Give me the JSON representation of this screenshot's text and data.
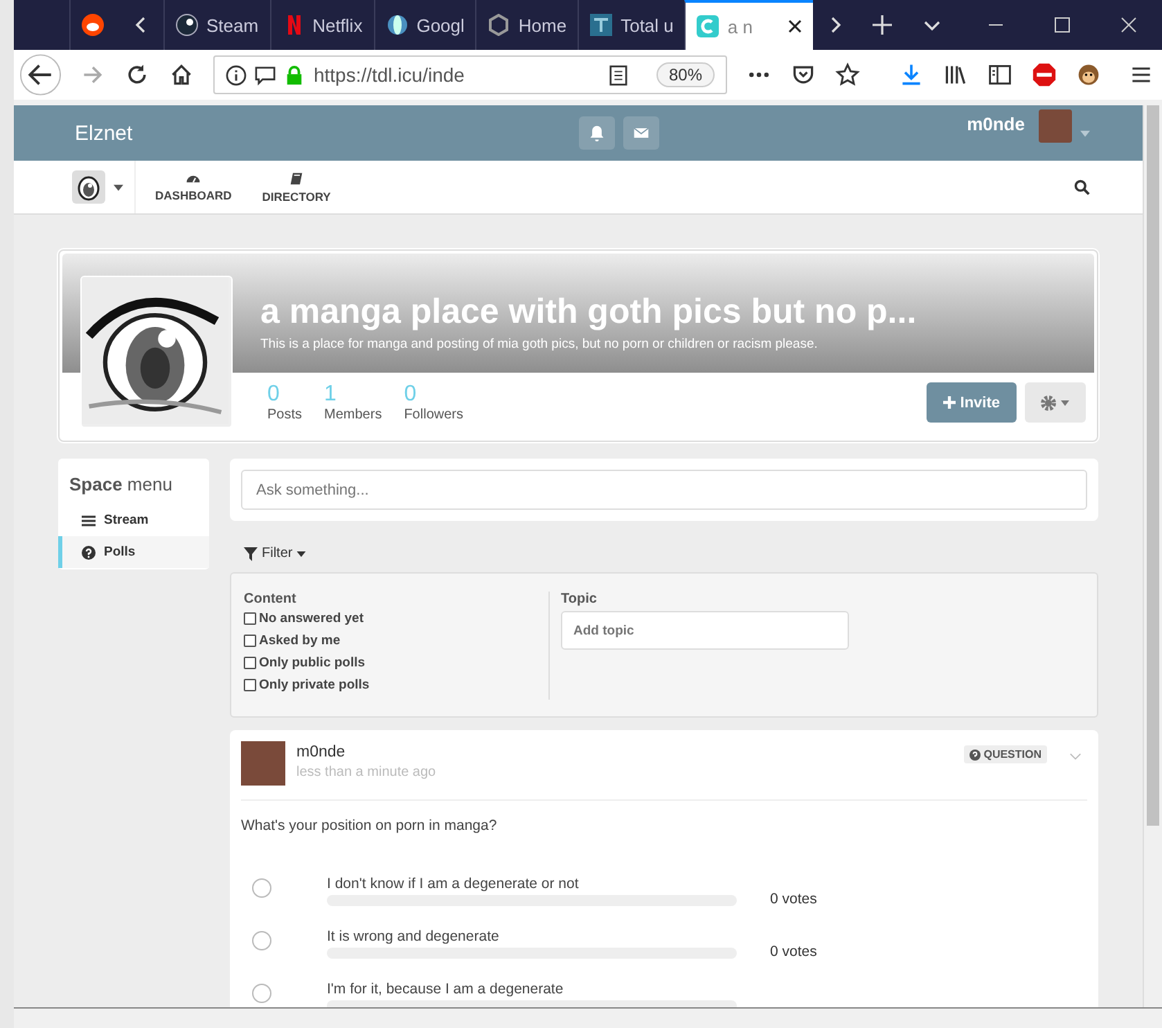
{
  "browser": {
    "tabs": [
      {
        "kind": "reddit",
        "selected": false
      },
      {
        "label": "Steam",
        "kind": "steam",
        "selected": false
      },
      {
        "label": "Netflix",
        "kind": "netflix",
        "selected": false
      },
      {
        "label": "Googl",
        "kind": "globe",
        "selected": false
      },
      {
        "label": "Home",
        "kind": "hex",
        "selected": false
      },
      {
        "label": "Total u",
        "kind": "square",
        "selected": false
      },
      {
        "label": "a n",
        "kind": "app",
        "selected": true
      }
    ],
    "url": "https://tdl.icu/inde",
    "zoom": "80%"
  },
  "navbar": {
    "brand": "Elznet",
    "user": "m0nde"
  },
  "nav": [
    {
      "label": "DASHBOARD",
      "kind": "dashboard"
    },
    {
      "label": "DIRECTORY",
      "kind": "book"
    }
  ],
  "space": {
    "title": "a manga place with goth pics but no p...",
    "description": "This is a place for manga and posting of mia goth pics, but no porn or children or racism please.",
    "stats": [
      {
        "value": "0",
        "label": "Posts"
      },
      {
        "value": "1",
        "label": "Members"
      },
      {
        "value": "0",
        "label": "Followers"
      }
    ],
    "invite": "Invite"
  },
  "menu": {
    "title": "**Space** menu",
    "items": [
      {
        "label": "Stream",
        "kind": "list",
        "selected": false
      },
      {
        "label": "Polls",
        "kind": "question",
        "selected": true
      }
    ]
  },
  "ask": {
    "placeholder": "Ask something..."
  },
  "filter": {
    "label": "Filter",
    "content_heading": "Content",
    "options": [
      {
        "label": "No answered yet",
        "checked": false
      },
      {
        "label": "Asked by me",
        "checked": false
      },
      {
        "label": "Only public polls",
        "checked": false
      },
      {
        "label": "Only private polls",
        "checked": false
      }
    ],
    "topic_heading": "Topic",
    "topic_placeholder": "Add topic"
  },
  "post": {
    "author": "m0nde",
    "time": "less than a minute ago",
    "badge": "QUESTION",
    "question": "What's your position on porn in manga?",
    "options": [
      {
        "label": "I don't know if I am a degenerate or not",
        "checked": false,
        "level": 0,
        "votes": "0 votes"
      },
      {
        "label": "It is wrong and degenerate",
        "checked": false,
        "level": 0,
        "votes": "0 votes"
      },
      {
        "label": "I'm for it, because I am a degenerate",
        "checked": false,
        "level": 0
      }
    ]
  }
}
